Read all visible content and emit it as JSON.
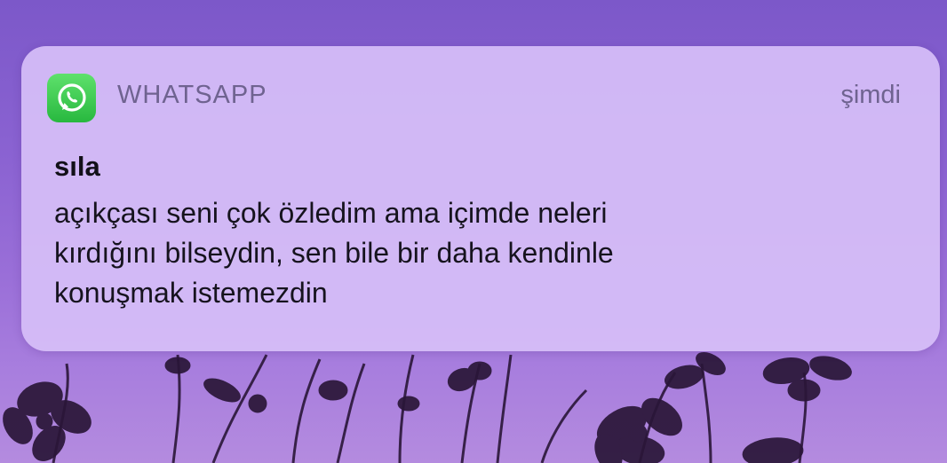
{
  "notification": {
    "app_name": "WHATSAPP",
    "app_icon": "whatsapp-icon",
    "time": "şimdi",
    "sender": "sıla",
    "message": "açıkçası seni çok özledim ama içimde neleri\nkırdığını bilseydin, sen bile bir daha kendinle\nkonuşmak istemezdin"
  },
  "colors": {
    "background_top": "#7c58c9",
    "background_bottom": "#b48bdf",
    "card": "#d6bef8",
    "whatsapp_green": "#2fbe45",
    "flowers": "#2a1638"
  }
}
